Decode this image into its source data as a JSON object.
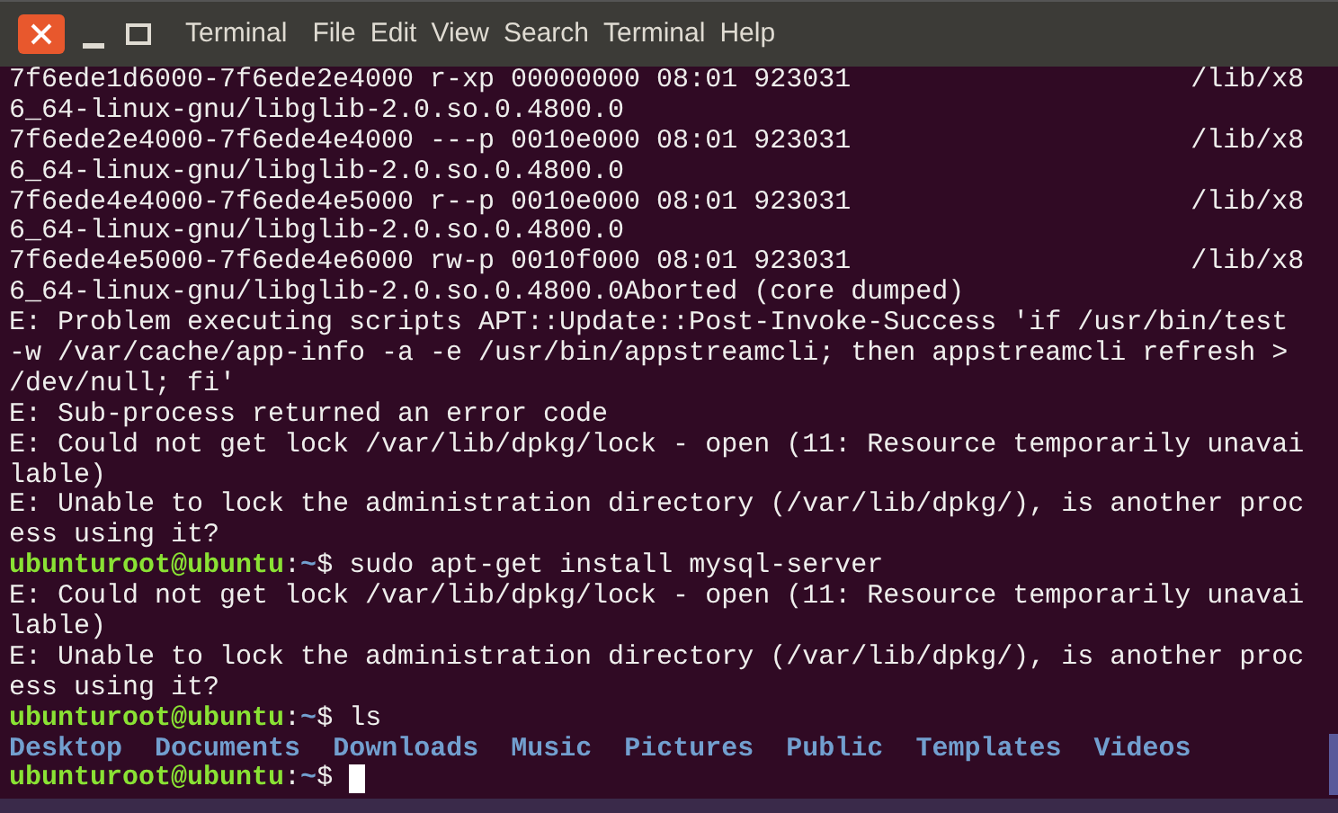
{
  "menu_bar": {
    "app_title": "Terminal",
    "items": [
      "File",
      "Edit",
      "View",
      "Search",
      "Terminal",
      "Help"
    ]
  },
  "terminal": {
    "lines": [
      {
        "kind": "output",
        "text": "7f6ede1d6000-7f6ede2e4000 r-xp 00000000 08:01 923031                     /lib/x8"
      },
      {
        "kind": "output",
        "text": "6_64-linux-gnu/libglib-2.0.so.0.4800.0"
      },
      {
        "kind": "output",
        "text": "7f6ede2e4000-7f6ede4e4000 ---p 0010e000 08:01 923031                     /lib/x8"
      },
      {
        "kind": "output",
        "text": "6_64-linux-gnu/libglib-2.0.so.0.4800.0"
      },
      {
        "kind": "output",
        "text": "7f6ede4e4000-7f6ede4e5000 r--p 0010e000 08:01 923031                     /lib/x8"
      },
      {
        "kind": "output",
        "text": "6_64-linux-gnu/libglib-2.0.so.0.4800.0"
      },
      {
        "kind": "output",
        "text": "7f6ede4e5000-7f6ede4e6000 rw-p 0010f000 08:01 923031                     /lib/x8"
      },
      {
        "kind": "output",
        "text": "6_64-linux-gnu/libglib-2.0.so.0.4800.0Aborted (core dumped)"
      },
      {
        "kind": "output",
        "text": "E: Problem executing scripts APT::Update::Post-Invoke-Success 'if /usr/bin/test"
      },
      {
        "kind": "output",
        "text": "-w /var/cache/app-info -a -e /usr/bin/appstreamcli; then appstreamcli refresh >"
      },
      {
        "kind": "output",
        "text": "/dev/null; fi'"
      },
      {
        "kind": "output",
        "text": "E: Sub-process returned an error code"
      },
      {
        "kind": "output",
        "text": "E: Could not get lock /var/lib/dpkg/lock - open (11: Resource temporarily unavai"
      },
      {
        "kind": "output",
        "text": "lable)"
      },
      {
        "kind": "output",
        "text": "E: Unable to lock the administration directory (/var/lib/dpkg/), is another proc"
      },
      {
        "kind": "output",
        "text": "ess using it?"
      },
      {
        "kind": "prompt",
        "user": "ubunturoot@ubuntu",
        "separator": ":",
        "path": "~",
        "symbol": "$",
        "command": "sudo apt-get install mysql-server",
        "cursor": false
      },
      {
        "kind": "output",
        "text": "E: Could not get lock /var/lib/dpkg/lock - open (11: Resource temporarily unavai"
      },
      {
        "kind": "output",
        "text": "lable)"
      },
      {
        "kind": "output",
        "text": "E: Unable to lock the administration directory (/var/lib/dpkg/), is another proc"
      },
      {
        "kind": "output",
        "text": "ess using it?"
      },
      {
        "kind": "prompt",
        "user": "ubunturoot@ubuntu",
        "separator": ":",
        "path": "~",
        "symbol": "$",
        "command": "ls",
        "cursor": false
      },
      {
        "kind": "listing",
        "entries": [
          "Desktop",
          "Documents",
          "Downloads",
          "Music",
          "Pictures",
          "Public",
          "Templates",
          "Videos"
        ]
      },
      {
        "kind": "prompt",
        "user": "ubunturoot@ubuntu",
        "separator": ":",
        "path": "~",
        "symbol": "$",
        "cursor": true
      }
    ]
  }
}
